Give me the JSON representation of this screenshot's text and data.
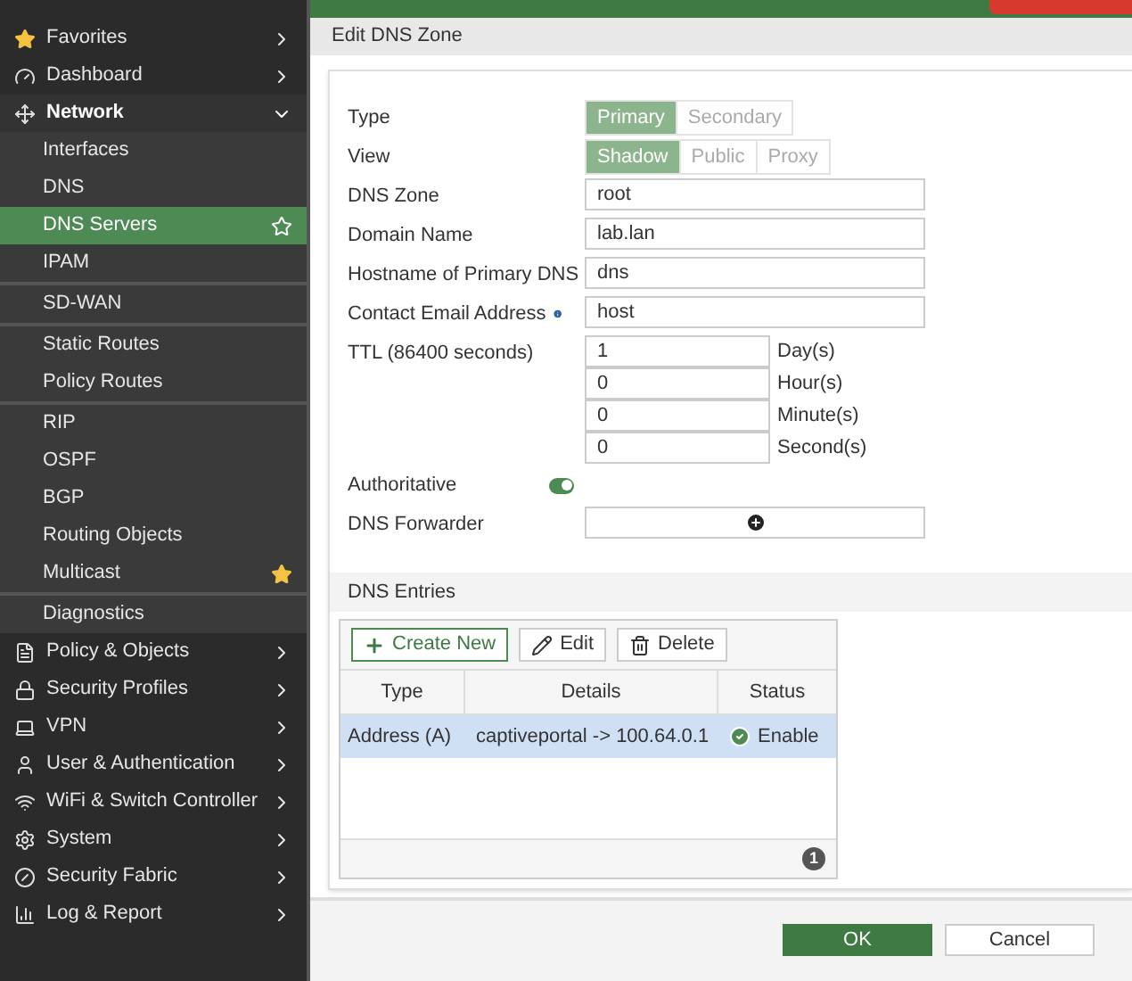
{
  "sidebar": {
    "items": [
      {
        "label": "Favorites",
        "expanded": false,
        "selected": false
      },
      {
        "label": "Dashboard",
        "expanded": false,
        "selected": false
      },
      {
        "label": "Network",
        "expanded": true,
        "selected": false,
        "children": [
          {
            "label": "Interfaces",
            "selected": false,
            "separator_below": false
          },
          {
            "label": "DNS",
            "selected": false,
            "separator_below": false
          },
          {
            "label": "DNS Servers",
            "selected": true,
            "separator_below": false,
            "favorite": false
          },
          {
            "label": "IPAM",
            "selected": false,
            "separator_below": true
          },
          {
            "label": "SD-WAN",
            "selected": false,
            "separator_below": true
          },
          {
            "label": "Static Routes",
            "selected": false,
            "separator_below": false
          },
          {
            "label": "Policy Routes",
            "selected": false,
            "separator_below": true
          },
          {
            "label": "RIP",
            "selected": false,
            "separator_below": false
          },
          {
            "label": "OSPF",
            "selected": false,
            "separator_below": false
          },
          {
            "label": "BGP",
            "selected": false,
            "separator_below": false
          },
          {
            "label": "Routing Objects",
            "selected": false,
            "separator_below": false
          },
          {
            "label": "Multicast",
            "selected": false,
            "separator_below": true,
            "favorite": true
          },
          {
            "label": "Diagnostics",
            "selected": false,
            "separator_below": false
          }
        ]
      },
      {
        "label": "Policy & Objects",
        "expanded": false,
        "selected": false
      },
      {
        "label": "Security Profiles",
        "expanded": false,
        "selected": false
      },
      {
        "label": "VPN",
        "expanded": false,
        "selected": false
      },
      {
        "label": "User & Authentication",
        "expanded": false,
        "selected": false
      },
      {
        "label": "WiFi & Switch Controller",
        "expanded": false,
        "selected": false
      },
      {
        "label": "System",
        "expanded": false,
        "selected": false
      },
      {
        "label": "Security Fabric",
        "expanded": false,
        "selected": false
      },
      {
        "label": "Log & Report",
        "expanded": false,
        "selected": false
      }
    ]
  },
  "page": {
    "title": "Edit DNS Zone"
  },
  "form": {
    "rows": [
      {
        "kind": "segmented",
        "label": "Type",
        "options": [
          {
            "label": "Primary",
            "selected": true
          },
          {
            "label": "Secondary",
            "selected": false
          }
        ]
      },
      {
        "kind": "segmented",
        "label": "View",
        "options": [
          {
            "label": "Shadow",
            "selected": true
          },
          {
            "label": "Public",
            "selected": false
          },
          {
            "label": "Proxy",
            "selected": false
          }
        ]
      },
      {
        "kind": "text",
        "label": "DNS Zone",
        "value": "root"
      },
      {
        "kind": "text",
        "label": "Domain Name",
        "value": "lab.lan"
      },
      {
        "kind": "text",
        "label": "Hostname of Primary DNS",
        "value": "dns"
      },
      {
        "kind": "text",
        "label": "Contact Email Address",
        "value": "host",
        "info": true
      },
      {
        "kind": "ttl",
        "label": "TTL (86400 seconds)",
        "parts": [
          {
            "value": "1",
            "unit": "Day(s)"
          },
          {
            "value": "0",
            "unit": "Hour(s)"
          },
          {
            "value": "0",
            "unit": "Minute(s)"
          },
          {
            "value": "0",
            "unit": "Second(s)"
          }
        ]
      },
      {
        "kind": "toggle",
        "label": "Authoritative",
        "on": true
      },
      {
        "kind": "add",
        "label": "DNS Forwarder"
      }
    ]
  },
  "entries": {
    "title": "DNS Entries",
    "buttons": [
      "Create New",
      "Edit",
      "Delete"
    ],
    "columns": [
      "Type",
      "Details",
      "Status"
    ],
    "rows": [
      {
        "type": "Address (A)",
        "details": "captiveportal -> 100.64.0.1",
        "status": "Enable",
        "selected": true,
        "enabled": true
      }
    ],
    "count": "1"
  },
  "footer": {
    "ok": "OK",
    "cancel": "Cancel"
  }
}
